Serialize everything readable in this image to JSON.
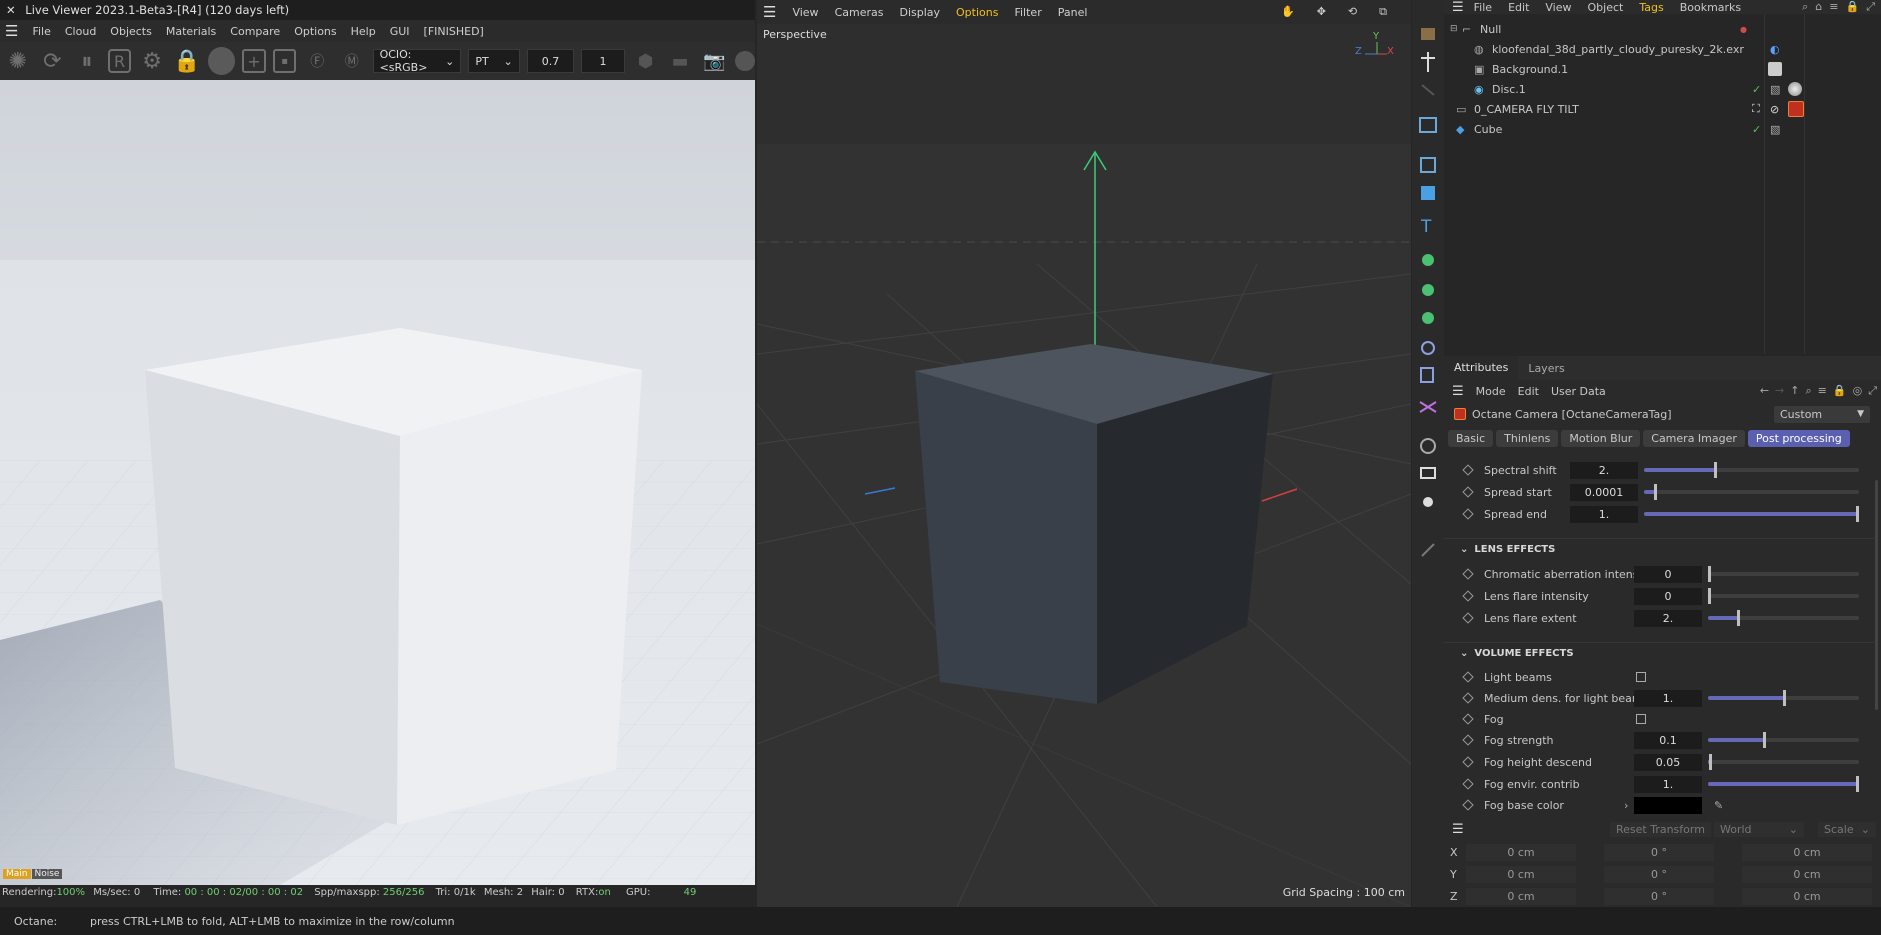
{
  "live_viewer": {
    "title": "Live Viewer 2023.1-Beta3-[R4] (120 days left)",
    "menu": [
      "File",
      "Cloud",
      "Objects",
      "Materials",
      "Compare",
      "Options",
      "Help",
      "GUI",
      "[FINISHED]"
    ],
    "ocio": "OCIO:<sRGB>",
    "kernel": "PT",
    "value1": "0.7",
    "value2": "1",
    "channel_tabs": [
      "Main",
      "Noise"
    ],
    "status": {
      "rendering_label": "Rendering:",
      "rendering_val": "100%",
      "mssec_label": "Ms/sec:",
      "mssec_val": "0",
      "time_label": "Time:",
      "time_val": "00 : 00 : 02/00 : 00 : 02",
      "spp_label": "Spp/maxspp:",
      "spp_val": "256/256",
      "tri_label": "Tri:",
      "tri_val": "0/1k",
      "mesh_label": "Mesh:",
      "mesh_val": "2",
      "hair_label": "Hair:",
      "hair_val": "0",
      "rtx_label": "RTX:",
      "rtx_val": "on",
      "gpu_label": "GPU:",
      "gpu_val": "49"
    }
  },
  "viewport": {
    "menu": [
      "View",
      "Cameras",
      "Display",
      "Options",
      "Filter",
      "Panel"
    ],
    "active_menu": "Options",
    "camera_label": "Perspective",
    "grid_spacing": "Grid Spacing : 100 cm",
    "axis_labels": {
      "x": "X",
      "y": "Y",
      "z": "Z"
    }
  },
  "object_manager": {
    "menu": [
      "File",
      "Edit",
      "View",
      "Object",
      "Tags",
      "Bookmarks"
    ],
    "active_menu": "Tags",
    "objects": [
      {
        "name": "Null",
        "indent": 0
      },
      {
        "name": "kloofendal_38d_partly_cloudy_puresky_2k.exr",
        "indent": 1
      },
      {
        "name": "Background.1",
        "indent": 1
      },
      {
        "name": "Disc.1",
        "indent": 1
      },
      {
        "name": "0_CAMERA FLY TILT",
        "indent": 0
      },
      {
        "name": "Cube",
        "indent": 0
      }
    ]
  },
  "attributes": {
    "tabs": [
      "Attributes",
      "Layers"
    ],
    "menu": [
      "Mode",
      "Edit",
      "User Data"
    ],
    "object_title": "Octane Camera [OctaneCameraTag]",
    "preset": "Custom",
    "subtabs": [
      "Basic",
      "Thinlens",
      "Motion Blur",
      "Camera Imager",
      "Post processing"
    ],
    "active_subtab": "Post processing",
    "rows_top": [
      {
        "label": "Spectral shift",
        "value": "2.",
        "fraction": 0.33
      },
      {
        "label": "Spread start",
        "value": "0.0001",
        "fraction": 0.05
      },
      {
        "label": "Spread end",
        "value": "1.",
        "fraction": 1.0
      }
    ],
    "lens_section": "LENS EFFECTS",
    "lens_rows": [
      {
        "label": "Chromatic aberration intensity",
        "value": "0",
        "fraction": 0.0
      },
      {
        "label": "Lens flare intensity",
        "value": "0",
        "fraction": 0.0
      },
      {
        "label": "Lens flare extent",
        "value": "2.",
        "fraction": 0.2
      }
    ],
    "volume_section": "VOLUME EFFECTS",
    "volume_rows": [
      {
        "label": "Light beams",
        "type": "check"
      },
      {
        "label": "Medium dens. for light beams",
        "value": "1.",
        "fraction": 0.5
      },
      {
        "label": "Fog",
        "type": "check"
      },
      {
        "label": "Fog strength",
        "value": "0.1",
        "fraction": 0.37
      },
      {
        "label": "Fog height descend",
        "value": "0.05",
        "fraction": 0.01
      },
      {
        "label": "Fog envir. contrib",
        "value": "1.",
        "fraction": 1.0
      },
      {
        "label": "Fog base color",
        "type": "color"
      }
    ]
  },
  "coordinates": {
    "reset": "Reset Transform",
    "space": "World",
    "mode": "Scale",
    "rows": [
      {
        "axis": "X",
        "pos": "0 cm",
        "rot": "0 °",
        "scale": "0 cm"
      },
      {
        "axis": "Y",
        "pos": "0 cm",
        "rot": "0 °",
        "scale": "0 cm"
      },
      {
        "axis": "Z",
        "pos": "0 cm",
        "rot": "0 °",
        "scale": "0 cm"
      }
    ]
  },
  "statusbar": {
    "label": "Octane:",
    "message": "press CTRL+LMB to fold, ALT+LMB to maximize in the row/column"
  },
  "colors": {
    "accent": "#5b5fb0",
    "active_menu": "#f0c020",
    "slider": "#6669b8"
  }
}
